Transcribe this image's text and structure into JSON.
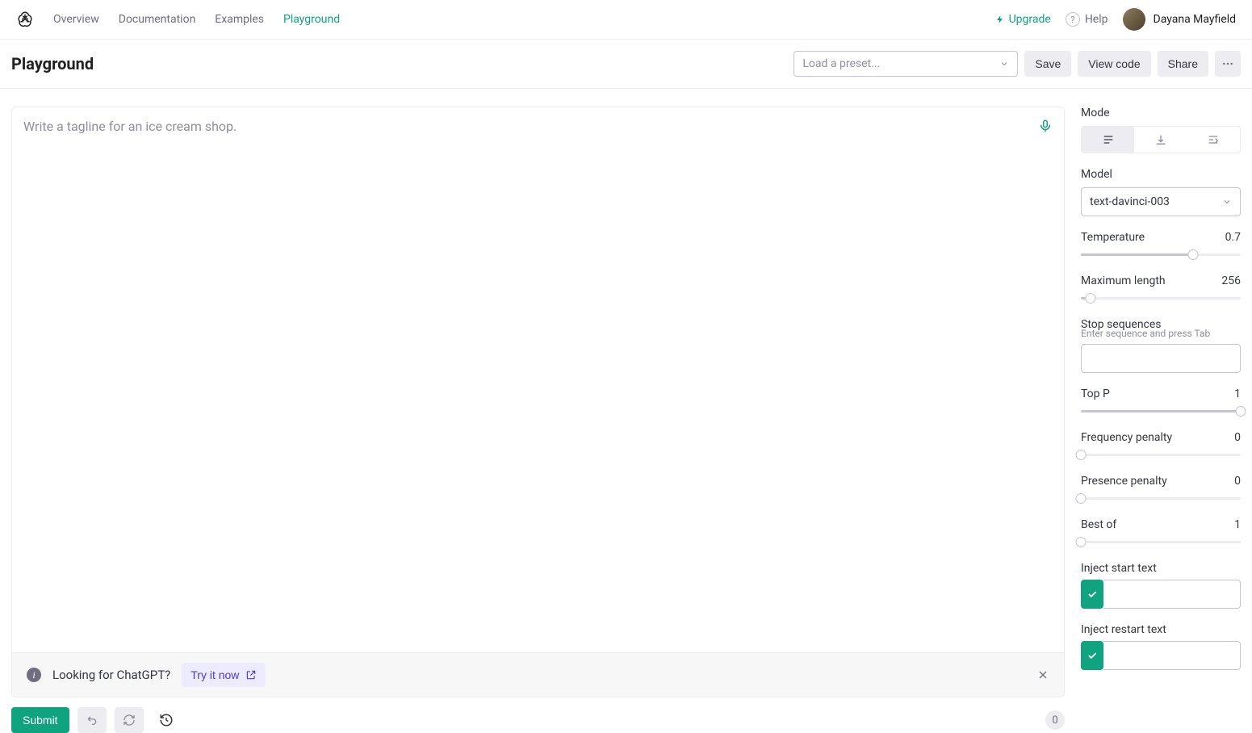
{
  "nav": {
    "links": [
      "Overview",
      "Documentation",
      "Examples",
      "Playground"
    ],
    "active_index": 3,
    "upgrade": "Upgrade",
    "help": "Help",
    "user_name": "Dayana Mayfield"
  },
  "page": {
    "title": "Playground",
    "preset_placeholder": "Load a preset...",
    "save": "Save",
    "view_code": "View code",
    "share": "Share"
  },
  "editor": {
    "placeholder": "Write a tagline for an ice cream shop."
  },
  "banner": {
    "text": "Looking for ChatGPT?",
    "cta": "Try it now"
  },
  "footer": {
    "submit": "Submit",
    "token_count": "0"
  },
  "sidebar": {
    "mode_label": "Mode",
    "model_label": "Model",
    "model_value": "text-davinci-003",
    "temperature": {
      "label": "Temperature",
      "value": "0.7",
      "percent": 70
    },
    "max_length": {
      "label": "Maximum length",
      "value": "256",
      "percent": 6
    },
    "stop": {
      "label": "Stop sequences",
      "sublabel": "Enter sequence and press Tab"
    },
    "top_p": {
      "label": "Top P",
      "value": "1",
      "percent": 100
    },
    "freq_penalty": {
      "label": "Frequency penalty",
      "value": "0",
      "percent": 0
    },
    "pres_penalty": {
      "label": "Presence penalty",
      "value": "0",
      "percent": 0
    },
    "best_of": {
      "label": "Best of",
      "value": "1",
      "percent": 0
    },
    "inject_start": {
      "label": "Inject start text",
      "checked": true
    },
    "inject_restart": {
      "label": "Inject restart text",
      "checked": true
    }
  }
}
